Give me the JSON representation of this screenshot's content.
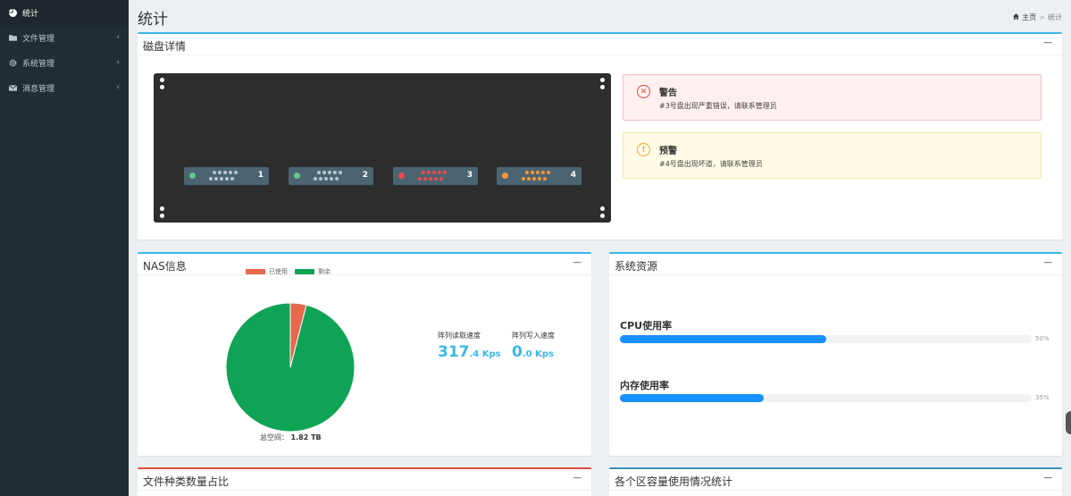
{
  "sidebar": {
    "items": [
      {
        "label": "统计",
        "icon": "pie-chart-icon",
        "active": true
      },
      {
        "label": "文件管理",
        "icon": "folder-icon",
        "chevron": "‹"
      },
      {
        "label": "系统管理",
        "icon": "gear-icon",
        "chevron": "‹"
      },
      {
        "label": "消息管理",
        "icon": "envelope-icon",
        "chevron": "‹"
      }
    ]
  },
  "header": {
    "title": "统计",
    "breadcrumb": {
      "home": "主页",
      "sep": ">",
      "current": "统计"
    }
  },
  "disk_box": {
    "title": "磁盘详情",
    "collapse": "−",
    "disks": [
      {
        "number": "1",
        "status_color": "#5fca8b",
        "dot_color": "#b5c6cf"
      },
      {
        "number": "2",
        "status_color": "#5fca8b",
        "dot_color": "#b5c6cf"
      },
      {
        "number": "3",
        "status_color": "#f0474a",
        "dot_color": "#f0474a"
      },
      {
        "number": "4",
        "status_color": "#f59534",
        "dot_color": "#f59534"
      }
    ],
    "alerts": [
      {
        "type": "danger",
        "icon": "✕",
        "title": "警告",
        "message": "#3号盘出现严重错误，请联系管理员"
      },
      {
        "type": "warning",
        "icon": "!",
        "title": "预警",
        "message": "#4号盘出现坏道，请联系管理员"
      }
    ]
  },
  "nas_box": {
    "title": "NAS信息",
    "collapse": "−",
    "legend": [
      {
        "label": "已使用",
        "color": "#e8674f"
      },
      {
        "label": "剩余",
        "color": "#0fa455"
      }
    ],
    "used_fraction": 0.04,
    "total_label": "总空间：",
    "total_value": "1.82 TB",
    "read_label": "阵列读取速度",
    "read_int": "317",
    "read_dec": ".4 Kps",
    "write_label": "阵列写入速度",
    "write_int": "0",
    "write_dec": ".0 Kps"
  },
  "resource_box": {
    "title": "系统资源",
    "collapse": "−",
    "cpu_label": "CPU使用率",
    "cpu_percent": 50,
    "cpu_text": "50%",
    "mem_label": "内存使用率",
    "mem_percent": 35,
    "mem_text": "35%"
  },
  "file_box": {
    "title": "文件种类数量占比",
    "collapse": "−"
  },
  "partition_box": {
    "title": "各个区容量使用情况统计",
    "collapse": "−"
  }
}
